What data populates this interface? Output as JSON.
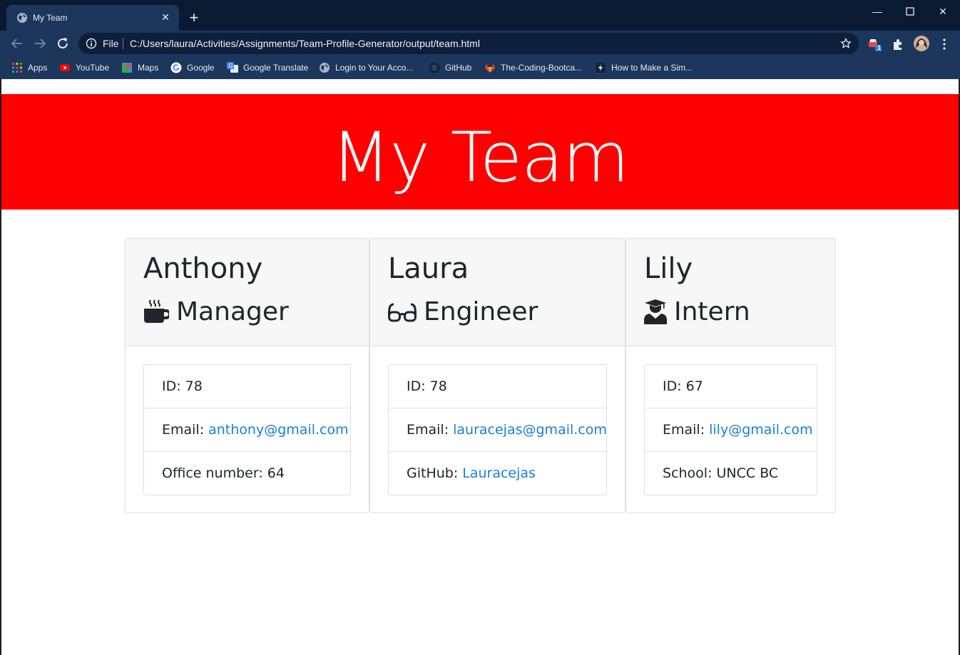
{
  "browser": {
    "tab_title": "My Team",
    "scheme_label": "File",
    "url": "C:/Users/laura/Activities/Assignments/Team-Profile-Generator/output/team.html",
    "extension_badge": "1",
    "bookmarks": [
      {
        "label": "Apps",
        "icon": "apps-grid-icon"
      },
      {
        "label": "YouTube",
        "icon": "youtube-icon"
      },
      {
        "label": "Maps",
        "icon": "maps-icon"
      },
      {
        "label": "Google",
        "icon": "google-icon"
      },
      {
        "label": "Google Translate",
        "icon": "google-translate-icon"
      },
      {
        "label": "Login to Your Acco...",
        "icon": "globe-icon"
      },
      {
        "label": "GitHub",
        "icon": "github-icon"
      },
      {
        "label": "The-Coding-Bootca...",
        "icon": "gitlab-icon"
      },
      {
        "label": "How to Make a Sim...",
        "icon": "site-icon"
      }
    ]
  },
  "page": {
    "title": "My Team",
    "accent_color": "#ff0000",
    "link_color": "#1a7fd8"
  },
  "team": [
    {
      "name": "Anthony",
      "role": "Manager",
      "role_icon": "mug-icon",
      "id_label": "ID: 78",
      "email_label": "Email:",
      "email": "anthony@gmail.com",
      "extra_label": "Office number: 64",
      "extra_link": ""
    },
    {
      "name": "Laura",
      "role": "Engineer",
      "role_icon": "glasses-icon",
      "id_label": "ID: 78",
      "email_label": "Email:",
      "email": "lauracejas@gmail.com",
      "extra_label": "GitHub:",
      "extra_link": "Lauracejas"
    },
    {
      "name": "Lily",
      "role": "Intern",
      "role_icon": "graduate-icon",
      "id_label": "ID: 67",
      "email_label": "Email:",
      "email": "lily@gmail.com",
      "extra_label": "School: UNCC BC",
      "extra_link": ""
    }
  ]
}
